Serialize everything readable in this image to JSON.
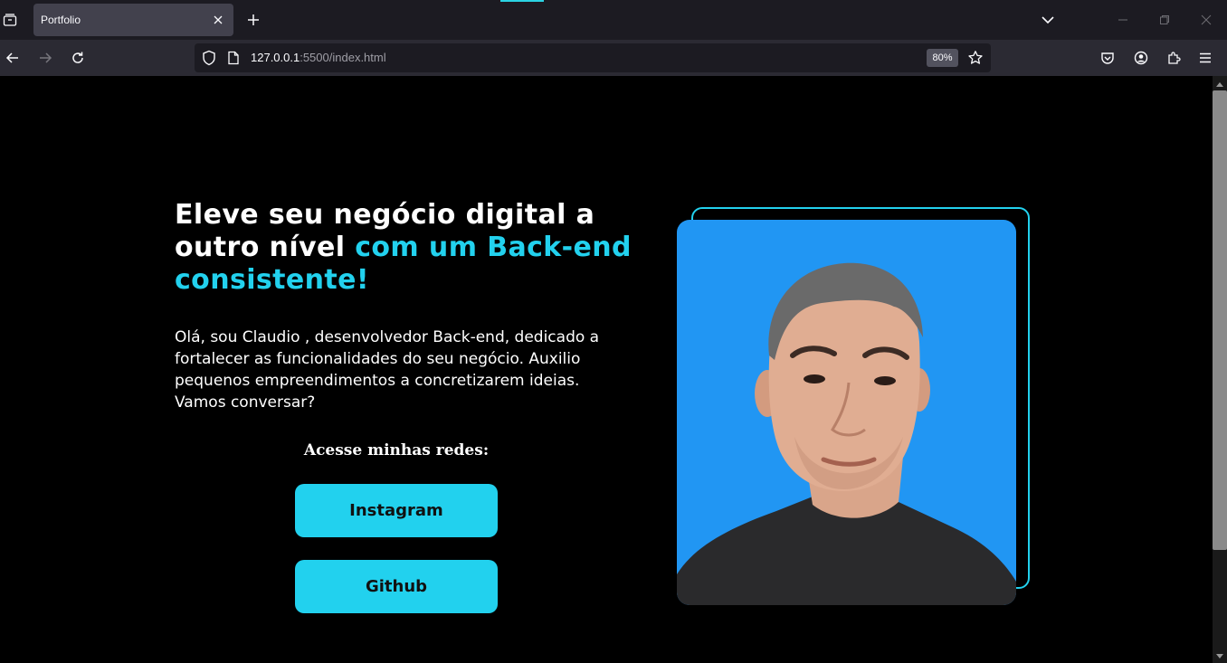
{
  "browser": {
    "tab_title": "Portfolio",
    "url_host": "127.0.0.1",
    "url_rest": ":5500/index.html",
    "zoom": "80%"
  },
  "hero": {
    "headline_white": "Eleve seu negócio digital a outro nível ",
    "headline_accent": "com um Back-end consistente!",
    "intro": "Olá, sou Claudio , desenvolvedor Back-end, dedicado a fortalecer as funcionalidades do seu negócio. Auxilio pequenos empreendimentos a concretizarem ideias. Vamos conversar?",
    "social_label": "Acesse minhas redes:",
    "buttons": [
      {
        "label": "Instagram"
      },
      {
        "label": "Github"
      }
    ]
  },
  "colors": {
    "accent": "#22d1ee",
    "photo_background": "#2196f3",
    "page_background": "#000000"
  }
}
